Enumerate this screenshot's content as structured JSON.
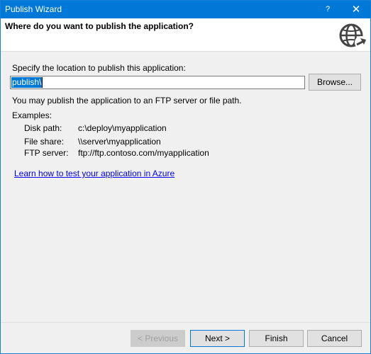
{
  "window": {
    "title": "Publish Wizard",
    "help_glyph": "?",
    "close_glyph": "✕"
  },
  "header": {
    "title": "Where do you want to publish the application?",
    "icon": "globe-publish-icon"
  },
  "location": {
    "label": "Specify the location to publish this application:",
    "value": "publish\\",
    "browse_label": "Browse..."
  },
  "info": {
    "ftp_text": "You may publish the application to an FTP server or file path.",
    "examples_label": "Examples:",
    "examples": [
      {
        "key": "Disk path:",
        "value": "c:\\deploy\\myapplication"
      },
      {
        "key": "File share:",
        "value": "\\\\server\\myapplication"
      },
      {
        "key": "FTP server:",
        "value": "ftp://ftp.contoso.com/myapplication"
      }
    ],
    "azure_link": "Learn how to test your application in Azure"
  },
  "footer": {
    "previous_label": "< Previous",
    "next_label": "Next >",
    "finish_label": "Finish",
    "cancel_label": "Cancel"
  },
  "colors": {
    "titlebar": "#0078d7",
    "selection": "#0078d7",
    "link": "#0000ee"
  }
}
